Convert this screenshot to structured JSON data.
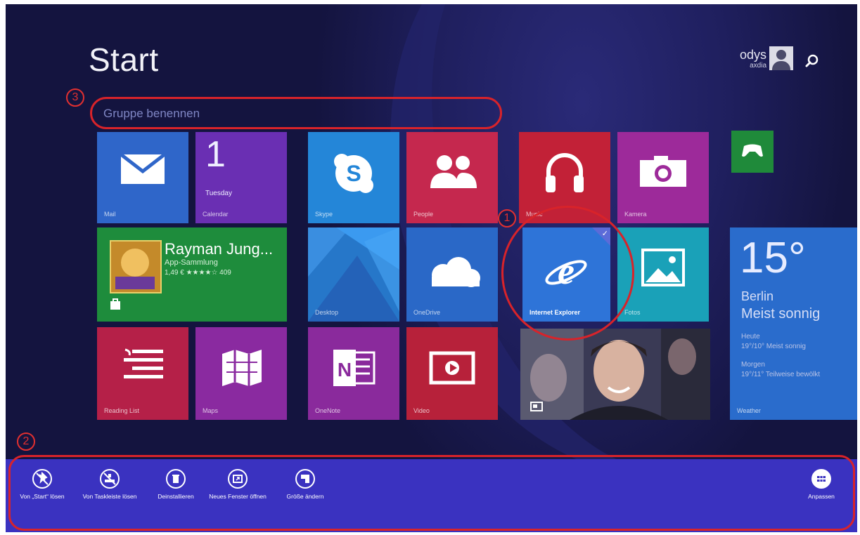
{
  "start": {
    "title": "Start"
  },
  "user": {
    "name": "odys",
    "sub": "axdia"
  },
  "annotations": {
    "one": "1",
    "two": "2",
    "three": "3"
  },
  "group": {
    "placeholder": "Gruppe benennen"
  },
  "tiles": {
    "mail": {
      "label": "Mail",
      "color": "#2f66c9"
    },
    "calendar": {
      "label": "Calendar",
      "day_number": "1",
      "day_name": "Tuesday",
      "color": "#6a2fb3"
    },
    "skype": {
      "label": "Skype",
      "color": "#2486d8"
    },
    "people": {
      "label": "People",
      "color": "#c5284e"
    },
    "music": {
      "label": "Music",
      "color": "#c22137"
    },
    "camera": {
      "label": "Kamera",
      "color": "#9d2a9a"
    },
    "xbox": {
      "label": "",
      "color": "#1f8a3a"
    },
    "store": {
      "title": "Rayman Jung...",
      "subtitle": "App-Sammlung",
      "price": "1,49 € ★★★★☆ 409",
      "color": "#1e8c3c"
    },
    "desktop": {
      "label": "Desktop",
      "color": "#2677c9"
    },
    "onedrive": {
      "label": "OneDrive",
      "color": "#2a68c7"
    },
    "ie": {
      "label": "Internet Explorer",
      "color": "#2e74d8"
    },
    "fotos": {
      "label": "Fotos",
      "color": "#1aa1b8"
    },
    "weather": {
      "temp": "15°",
      "city": "Berlin",
      "cond": "Meist sonnig",
      "today_label": "Heute",
      "today": "19°/10° Meist sonnig",
      "tomorrow_label": "Morgen",
      "tomorrow": "19°/11° Teilweise bewölkt",
      "label": "Weather",
      "color": "#2a6ccc"
    },
    "reading": {
      "label": "Reading List",
      "color": "#b52048"
    },
    "maps": {
      "label": "Maps",
      "color": "#8a2aa0"
    },
    "onenote": {
      "label": "OneNote",
      "color": "#8a2a9c"
    },
    "video": {
      "label": "Video",
      "color": "#b7213a"
    }
  },
  "appbar": {
    "unpin_start": "Von „Start“ lösen",
    "unpin_taskbar": "Von Taskleiste lösen",
    "uninstall": "Deinstallieren",
    "new_window": "Neues Fenster öffnen",
    "resize": "Größe ändern",
    "customize": "Anpassen"
  }
}
